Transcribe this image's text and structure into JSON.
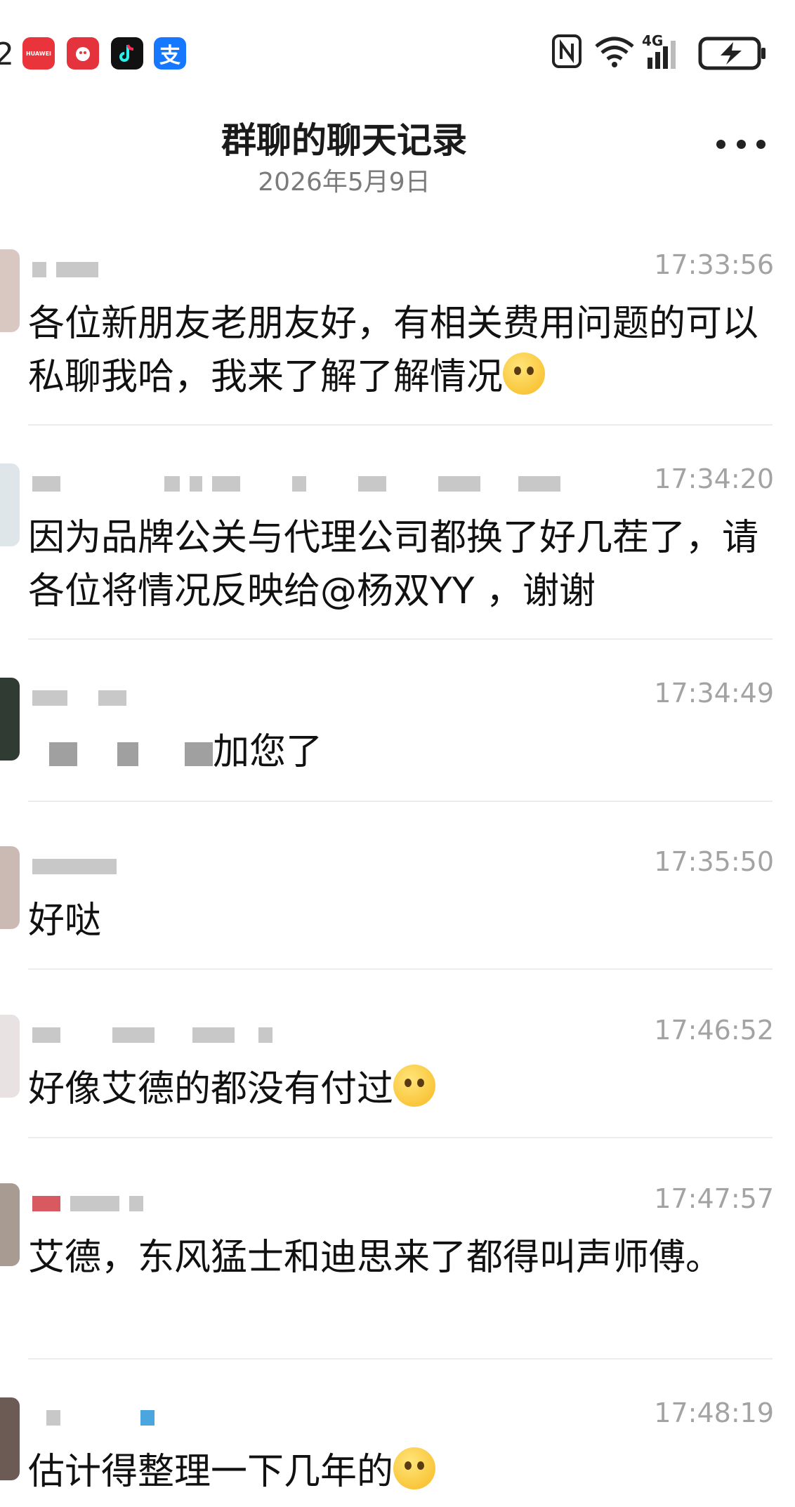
{
  "status_bar": {
    "time_fragment": "2",
    "apps": [
      {
        "icon": "huawei-appgallery-icon",
        "label": "HUAWEI",
        "color": "#e8343a"
      },
      {
        "icon": "shopping-app-icon",
        "label": "",
        "color": "#e4333d"
      },
      {
        "icon": "tiktok-icon",
        "label": "",
        "color": "#111111"
      },
      {
        "icon": "alipay-icon",
        "label": "支",
        "color": "#1677ff"
      }
    ],
    "network": "4G"
  },
  "header": {
    "title": "群聊的聊天记录",
    "date": "2026年5月9日"
  },
  "messages": [
    {
      "time": "17:33:56",
      "text": "各位新朋友老朋友好，有相关费用问题的可以私聊我哈，我来了解了解情况",
      "emoji": "pleading-face-icon",
      "avatar_color": "#d9c7c2"
    },
    {
      "time": "17:34:20",
      "text": "因为品牌公关与代理公司都换了好几茬了，请各位将情况反映给@杨双YY ，谢谢",
      "emoji": "",
      "avatar_color": "#dfe6ea"
    },
    {
      "time": "17:34:49",
      "text": "加您了",
      "emoji": "",
      "avatar_color": "#2f3b33"
    },
    {
      "time": "17:35:50",
      "text": "好哒",
      "emoji": "",
      "avatar_color": "#cbb9b4"
    },
    {
      "time": "17:46:52",
      "text": "好像艾德的都没有付过",
      "emoji": "woozy-face-icon",
      "avatar_color": "#e8e2e2"
    },
    {
      "time": "17:47:57",
      "text": "艾德，东风猛士和迪思来了都得叫声师傅。",
      "emoji": "",
      "avatar_color": "#a79b92"
    },
    {
      "time": "17:48:19",
      "text": "估计得整理一下几年的",
      "emoji": "thinking-face-icon",
      "avatar_color": "#6c5b55"
    }
  ]
}
